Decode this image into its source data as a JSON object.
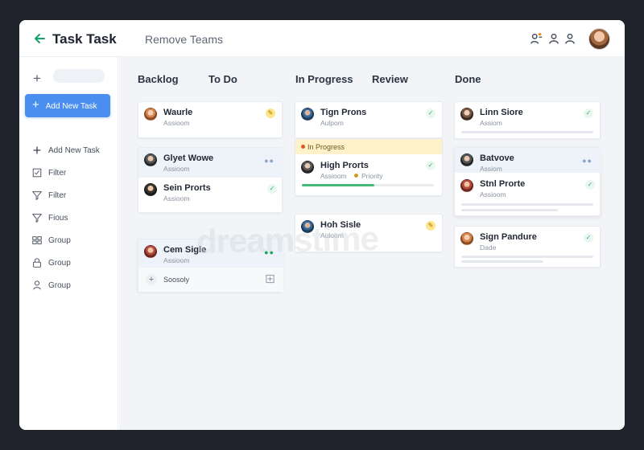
{
  "header": {
    "title": "Task Task",
    "subtitle": "Remove Teams"
  },
  "sidebar": {
    "primary": "Add New Task",
    "items": [
      "Add New Task",
      "Filter",
      "Filter",
      "Fious",
      "Group",
      "Group",
      "Group"
    ]
  },
  "columns": [
    "Backlog",
    "To Do",
    "In Progress",
    "Review",
    "Done"
  ],
  "cards": [
    {
      "title": "Waurle",
      "sub": "Assioom"
    },
    {
      "title": "Glyet Wowe",
      "sub": "Assioom"
    },
    {
      "title": "Sein Prorts",
      "sub": "Assioom"
    },
    {
      "title": "Cem Sigle",
      "sub": "Assioom"
    },
    {
      "title": "Tign Prons",
      "sub": "Aulpom"
    },
    {
      "title": "In Progress",
      "sub": ""
    },
    {
      "title": "High Prorts",
      "sub": "Assioom"
    },
    {
      "title": "Hoh Sisle",
      "sub": "Auloom"
    },
    {
      "title": "Linn Siore",
      "sub": "Assiom"
    },
    {
      "title": "Batvove",
      "sub": "Assiom"
    },
    {
      "title": "Stnl Prorte",
      "sub": "Assioom"
    },
    {
      "title": "Sign Pandure",
      "sub": "Dade"
    }
  ],
  "labels": {
    "priority": "Priority",
    "footer": "Soosoly"
  },
  "watermark": "dreamstime",
  "progress": {
    "high_prorts": 0.55
  },
  "colors": {
    "accent": "#4a8ff0",
    "success": "#46b97a",
    "warning": "#ffe58b"
  }
}
